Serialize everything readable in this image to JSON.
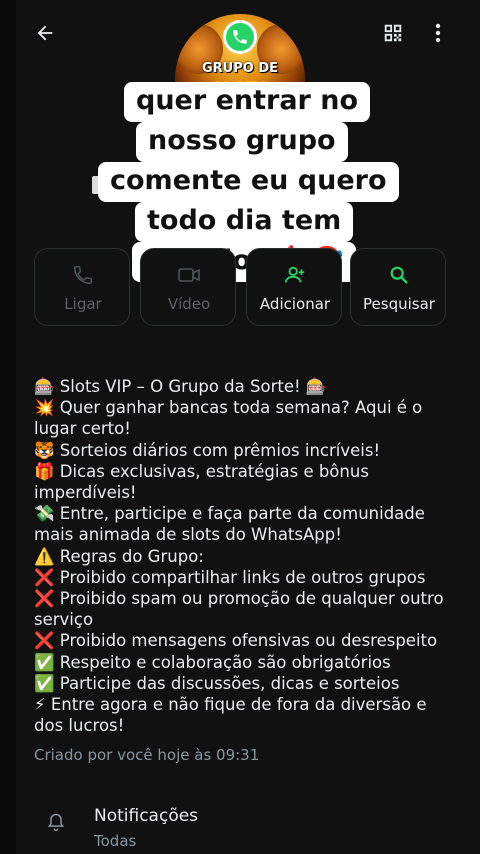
{
  "header": {
    "back_icon": "arrow-left-icon",
    "qr_icon": "qr-code-icon",
    "more_icon": "more-vertical-icon"
  },
  "avatar": {
    "line1": "GRUPO DE",
    "line2": "SLOTS"
  },
  "caption": {
    "lines": [
      "quer entrar no",
      "nosso grupo",
      "comente eu quero",
      "todo dia tem",
      "sorteios 🎰🎯"
    ]
  },
  "actions": [
    {
      "label": "Ligar",
      "icon": "phone-icon",
      "enabled": false
    },
    {
      "label": "Vídeo",
      "icon": "video-icon",
      "enabled": false
    },
    {
      "label": "Adicionar",
      "icon": "add-person-icon",
      "enabled": true
    },
    {
      "label": "Pesquisar",
      "icon": "search-icon",
      "enabled": true
    }
  ],
  "description": {
    "lines": [
      "🎰 Slots VIP – O Grupo da Sorte! 🎰",
      "💥 Quer ganhar bancas toda semana? Aqui é o",
      "lugar certo!",
      "🐯 Sorteios diários com prêmios incríveis!",
      "🎁 Dicas exclusivas, estratégias e bônus",
      "imperdíveis!",
      "💸 Entre, participe e faça parte da comunidade",
      "mais animada de slots do WhatsApp!",
      "⚠️ Regras do Grupo:",
      "❌ Proibido compartilhar links de outros grupos",
      "❌ Proibido spam ou promoção de qualquer outro",
      "serviço",
      "❌ Proibido mensagens ofensivas ou desrespeito",
      "✅ Respeito e colaboração são obrigatórios",
      "✅ Participe das discussões, dicas e sorteios",
      "⚡ Entre agora e não fique de fora da diversão e",
      "dos lucros!"
    ]
  },
  "created": "Criado por você hoje às 09:31",
  "notifications": {
    "title": "Notificações",
    "subtitle": "Todas"
  },
  "colors": {
    "background": "#111111",
    "accent": "#25d366",
    "muted_text": "#8696a0"
  }
}
